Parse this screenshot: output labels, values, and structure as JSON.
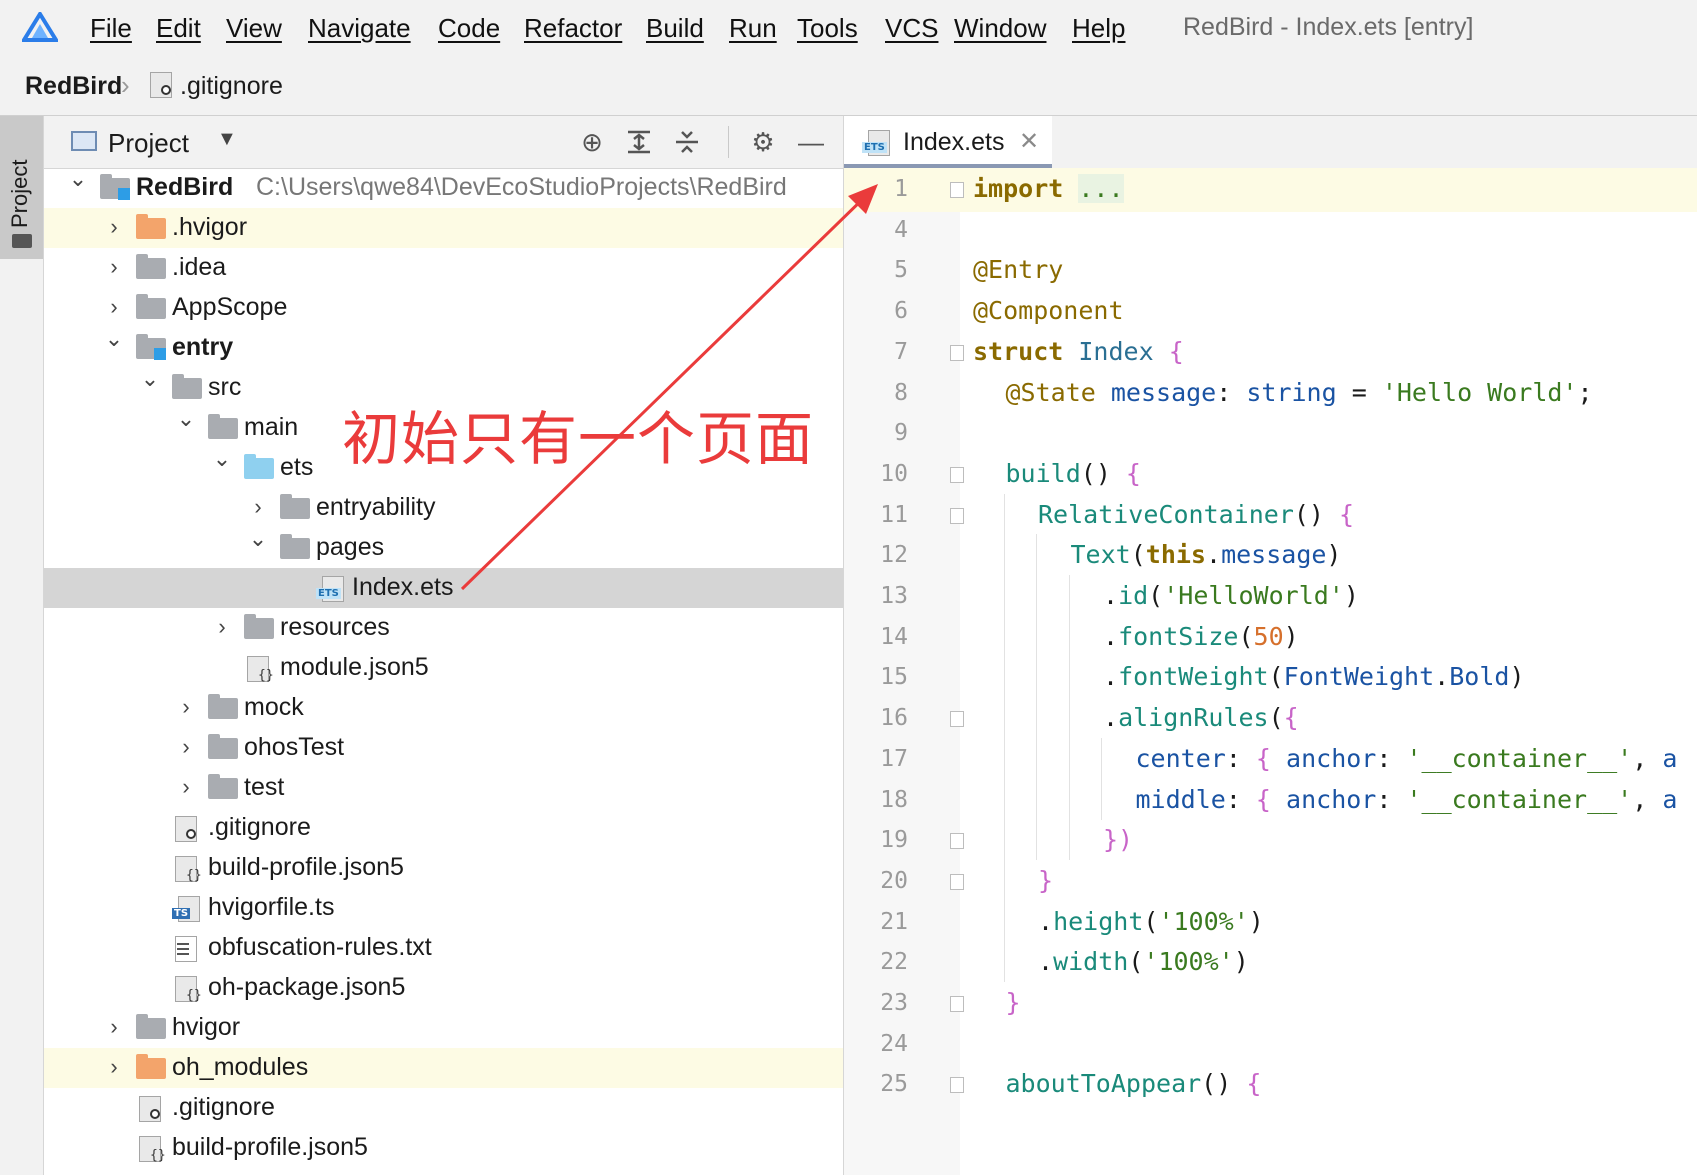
{
  "menubar": {
    "items": [
      "File",
      "Edit",
      "View",
      "Navigate",
      "Code",
      "Refactor",
      "Build",
      "Run",
      "Tools",
      "VCS",
      "Window",
      "Help"
    ],
    "window_title": "RedBird - Index.ets [entry]"
  },
  "breadcrumb": {
    "root": "RedBird",
    "file": ".gitignore"
  },
  "toolstrip": {
    "project_label": "Project"
  },
  "project_panel": {
    "title": "Project",
    "tools": [
      "locate-icon",
      "expand-all-icon",
      "collapse-all-icon",
      "gear-icon",
      "minimize-icon"
    ],
    "root_path": "C:\\Users\\qwe84\\DevEcoStudioProjects\\RedBird",
    "tree": [
      {
        "label": "RedBird",
        "depth": 0,
        "chevron": "open",
        "icon": "module-folder",
        "bold": true
      },
      {
        "label": ".hvigor",
        "depth": 1,
        "chevron": "closed",
        "icon": "folder-orange",
        "highlight": "yellow"
      },
      {
        "label": ".idea",
        "depth": 1,
        "chevron": "closed",
        "icon": "folder"
      },
      {
        "label": "AppScope",
        "depth": 1,
        "chevron": "closed",
        "icon": "folder"
      },
      {
        "label": "entry",
        "depth": 1,
        "chevron": "open",
        "icon": "module-folder",
        "bold": true
      },
      {
        "label": "src",
        "depth": 2,
        "chevron": "open",
        "icon": "folder"
      },
      {
        "label": "main",
        "depth": 3,
        "chevron": "open",
        "icon": "folder"
      },
      {
        "label": "ets",
        "depth": 4,
        "chevron": "open",
        "icon": "folder-blue"
      },
      {
        "label": "entryability",
        "depth": 5,
        "chevron": "closed",
        "icon": "folder"
      },
      {
        "label": "pages",
        "depth": 5,
        "chevron": "open",
        "icon": "folder"
      },
      {
        "label": "Index.ets",
        "depth": 6,
        "chevron": "none",
        "icon": "ets-file",
        "highlight": "selected"
      },
      {
        "label": "resources",
        "depth": 4,
        "chevron": "closed",
        "icon": "folder"
      },
      {
        "label": "module.json5",
        "depth": 4,
        "chevron": "none",
        "icon": "json-file"
      },
      {
        "label": "mock",
        "depth": 3,
        "chevron": "closed",
        "icon": "folder"
      },
      {
        "label": "ohosTest",
        "depth": 3,
        "chevron": "closed",
        "icon": "folder"
      },
      {
        "label": "test",
        "depth": 3,
        "chevron": "closed",
        "icon": "folder"
      },
      {
        "label": ".gitignore",
        "depth": 2,
        "chevron": "none",
        "icon": "ignore-file"
      },
      {
        "label": "build-profile.json5",
        "depth": 2,
        "chevron": "none",
        "icon": "json-file"
      },
      {
        "label": "hvigorfile.ts",
        "depth": 2,
        "chevron": "none",
        "icon": "ts-file"
      },
      {
        "label": "obfuscation-rules.txt",
        "depth": 2,
        "chevron": "none",
        "icon": "text-file"
      },
      {
        "label": "oh-package.json5",
        "depth": 2,
        "chevron": "none",
        "icon": "json-file"
      },
      {
        "label": "hvigor",
        "depth": 1,
        "chevron": "closed",
        "icon": "folder"
      },
      {
        "label": "oh_modules",
        "depth": 1,
        "chevron": "closed",
        "icon": "folder-orange",
        "highlight": "yellow"
      },
      {
        "label": ".gitignore",
        "depth": 1,
        "chevron": "none",
        "icon": "ignore-file"
      },
      {
        "label": "build-profile.json5",
        "depth": 1,
        "chevron": "none",
        "icon": "json-file"
      }
    ]
  },
  "annotation": {
    "text": "初始只有一个页面",
    "color": "#ea3b3b"
  },
  "editor": {
    "tab_label": "Index.ets",
    "lines": [
      {
        "n": "1",
        "indent": 0,
        "fold": true,
        "tokens": [
          [
            "kw",
            "import"
          ],
          [
            "plain",
            " "
          ],
          [
            "foldtext",
            "..."
          ]
        ]
      },
      {
        "n": "4",
        "indent": 0,
        "tokens": []
      },
      {
        "n": "5",
        "indent": 0,
        "tokens": [
          [
            "dec",
            "@Entry"
          ]
        ]
      },
      {
        "n": "6",
        "indent": 0,
        "tokens": [
          [
            "dec",
            "@Component"
          ]
        ]
      },
      {
        "n": "7",
        "indent": 0,
        "fold": true,
        "tokens": [
          [
            "kw",
            "struct"
          ],
          [
            "plain",
            " "
          ],
          [
            "id",
            "Index"
          ],
          [
            "plain",
            " "
          ],
          [
            "br",
            "{"
          ]
        ]
      },
      {
        "n": "8",
        "indent": 1,
        "tokens": [
          [
            "dec",
            "@State"
          ],
          [
            "plain",
            " "
          ],
          [
            "type",
            "message"
          ],
          [
            "plain",
            ": "
          ],
          [
            "type",
            "string"
          ],
          [
            "plain",
            " = "
          ],
          [
            "str",
            "'Hello World'"
          ],
          [
            "plain",
            ";"
          ]
        ]
      },
      {
        "n": "9",
        "indent": 0,
        "tokens": []
      },
      {
        "n": "10",
        "indent": 1,
        "fold": true,
        "tokens": [
          [
            "fn",
            "build"
          ],
          [
            "plain",
            "() "
          ],
          [
            "br",
            "{"
          ]
        ]
      },
      {
        "n": "11",
        "indent": 2,
        "fold": true,
        "tokens": [
          [
            "fn",
            "RelativeContainer"
          ],
          [
            "plain",
            "() "
          ],
          [
            "br",
            "{"
          ]
        ]
      },
      {
        "n": "12",
        "indent": 3,
        "tokens": [
          [
            "fn",
            "Text"
          ],
          [
            "plain",
            "("
          ],
          [
            "kw",
            "this"
          ],
          [
            "plain",
            "."
          ],
          [
            "type",
            "message"
          ],
          [
            "plain",
            ")"
          ]
        ]
      },
      {
        "n": "13",
        "indent": 4,
        "tokens": [
          [
            "plain",
            "."
          ],
          [
            "fn",
            "id"
          ],
          [
            "plain",
            "("
          ],
          [
            "str",
            "'HelloWorld'"
          ],
          [
            "plain",
            ")"
          ]
        ]
      },
      {
        "n": "14",
        "indent": 4,
        "tokens": [
          [
            "plain",
            "."
          ],
          [
            "fn",
            "fontSize"
          ],
          [
            "plain",
            "("
          ],
          [
            "num",
            "50"
          ],
          [
            "plain",
            ")"
          ]
        ]
      },
      {
        "n": "15",
        "indent": 4,
        "tokens": [
          [
            "plain",
            "."
          ],
          [
            "fn",
            "fontWeight"
          ],
          [
            "plain",
            "("
          ],
          [
            "type",
            "FontWeight"
          ],
          [
            "plain",
            "."
          ],
          [
            "type",
            "Bold"
          ],
          [
            "plain",
            ")"
          ]
        ]
      },
      {
        "n": "16",
        "indent": 4,
        "fold": true,
        "tokens": [
          [
            "plain",
            "."
          ],
          [
            "fn",
            "alignRules"
          ],
          [
            "plain",
            "("
          ],
          [
            "br",
            "{"
          ]
        ]
      },
      {
        "n": "17",
        "indent": 5,
        "tokens": [
          [
            "type",
            "center"
          ],
          [
            "plain",
            ": "
          ],
          [
            "br",
            "{"
          ],
          [
            "plain",
            " "
          ],
          [
            "type",
            "anchor"
          ],
          [
            "plain",
            ": "
          ],
          [
            "str",
            "'__container__'"
          ],
          [
            "plain",
            ", "
          ],
          [
            "type",
            "a"
          ]
        ]
      },
      {
        "n": "18",
        "indent": 5,
        "tokens": [
          [
            "type",
            "middle"
          ],
          [
            "plain",
            ": "
          ],
          [
            "br",
            "{"
          ],
          [
            "plain",
            " "
          ],
          [
            "type",
            "anchor"
          ],
          [
            "plain",
            ": "
          ],
          [
            "str",
            "'__container__'"
          ],
          [
            "plain",
            ", "
          ],
          [
            "type",
            "a"
          ]
        ]
      },
      {
        "n": "19",
        "indent": 4,
        "fold": true,
        "tokens": [
          [
            "br",
            "})"
          ]
        ]
      },
      {
        "n": "20",
        "indent": 2,
        "fold": true,
        "tokens": [
          [
            "br",
            "}"
          ]
        ]
      },
      {
        "n": "21",
        "indent": 2,
        "tokens": [
          [
            "plain",
            "."
          ],
          [
            "fn",
            "height"
          ],
          [
            "plain",
            "("
          ],
          [
            "str",
            "'100%'"
          ],
          [
            "plain",
            ")"
          ]
        ]
      },
      {
        "n": "22",
        "indent": 2,
        "tokens": [
          [
            "plain",
            "."
          ],
          [
            "fn",
            "width"
          ],
          [
            "plain",
            "("
          ],
          [
            "str",
            "'100%'"
          ],
          [
            "plain",
            ")"
          ]
        ]
      },
      {
        "n": "23",
        "indent": 1,
        "fold": true,
        "tokens": [
          [
            "br",
            "}"
          ]
        ]
      },
      {
        "n": "24",
        "indent": 0,
        "tokens": []
      },
      {
        "n": "25",
        "indent": 1,
        "fold": true,
        "tokens": [
          [
            "fn",
            "aboutToAppear"
          ],
          [
            "plain",
            "() "
          ],
          [
            "br",
            "{"
          ]
        ]
      }
    ]
  }
}
